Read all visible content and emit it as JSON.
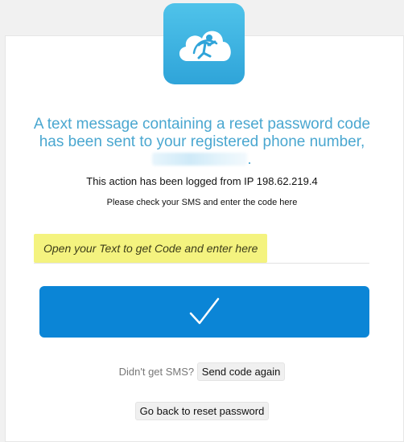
{
  "app": {
    "logo_icon": "cloud-figure-logo",
    "brand_color": "#2fa4d9"
  },
  "message": {
    "headline": "A text message containing a reset password code has been sent to your registered phone number,",
    "phone_masked": "",
    "headline_end": ".",
    "headline_color": "#4aa7d0",
    "ip_notice": "This action has been logged from IP 198.62.219.4",
    "instruction": "Please check your SMS and enter the code here"
  },
  "code_field": {
    "placeholder": "Open your Text to get Code and enter here",
    "value": ""
  },
  "submit": {
    "icon": "checkmark-icon",
    "color": "#0b85d6"
  },
  "resend": {
    "label": "Didn't get SMS?",
    "button_label": "Send code again"
  },
  "back": {
    "button_label": "Go back to reset password"
  }
}
